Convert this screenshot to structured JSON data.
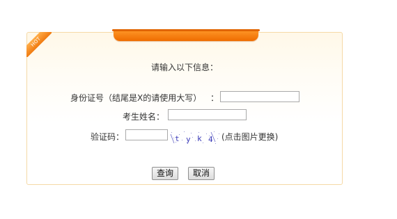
{
  "ribbon": {
    "text": "HOT"
  },
  "form": {
    "title": "请输入以下信息：",
    "id_label": "身份证号（结尾是X的请使用大写）",
    "id_colon": "：",
    "id_value": "",
    "name_label": "考生姓名：",
    "name_value": "",
    "captcha_label": "验证码：",
    "captcha_value": "",
    "captcha_chars": [
      "t",
      "y",
      "k",
      "4"
    ],
    "captcha_hint": "(点击图片更换)"
  },
  "buttons": {
    "query": "查询",
    "cancel": "取消"
  },
  "colors": {
    "accent": "#f07a10",
    "panel_border": "#f5d9a6",
    "captcha_text": "#3a3ab8"
  }
}
